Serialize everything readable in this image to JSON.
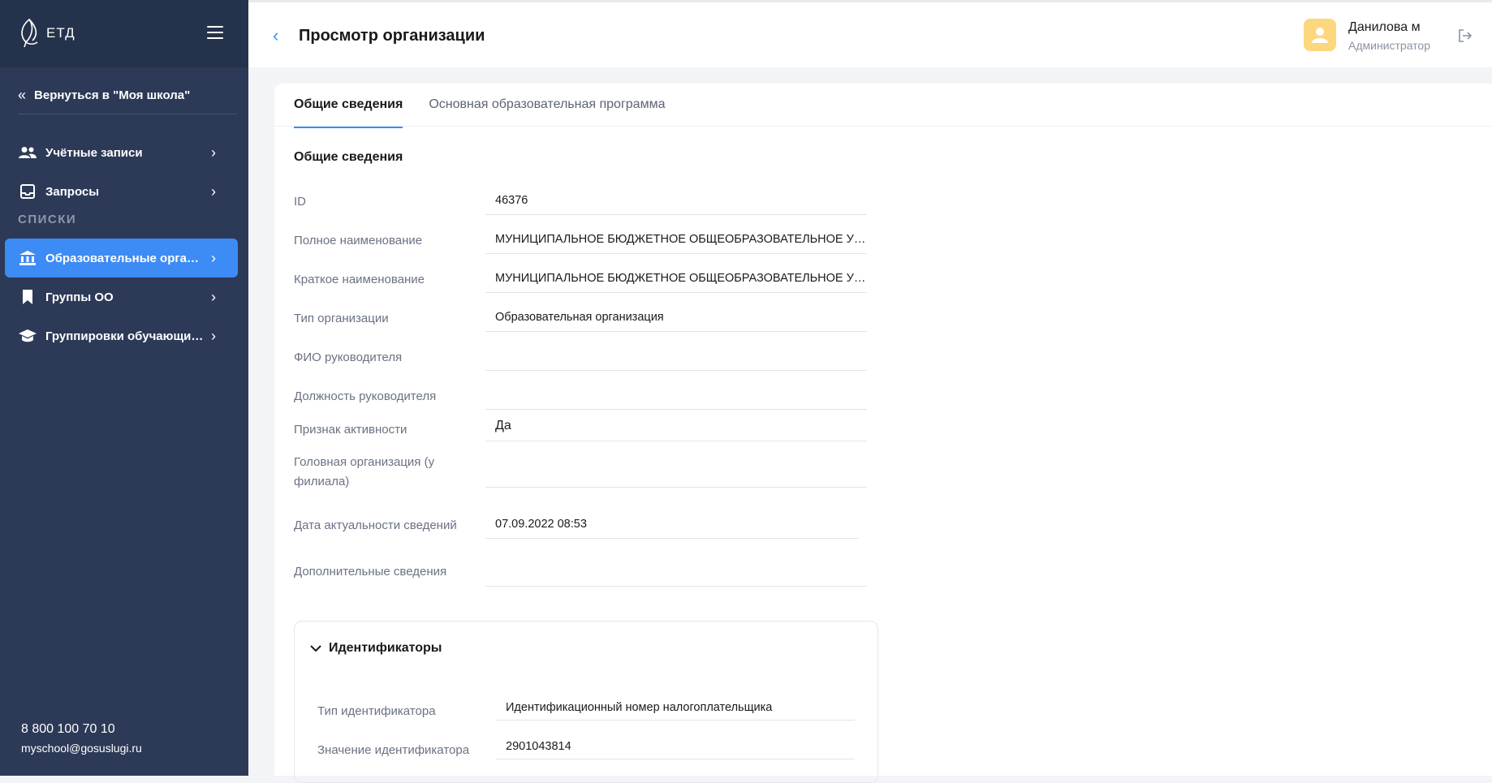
{
  "sidebar": {
    "logo_text": "ЕТД",
    "back_label": "Вернуться в \"Моя школа\"",
    "items_top": [
      {
        "label": "Учётные записи",
        "icon": "users-icon"
      },
      {
        "label": "Запросы",
        "icon": "inbox-icon"
      }
    ],
    "section_label": "СПИСКИ",
    "items_lists": [
      {
        "label": "Образовательные организа...",
        "icon": "institution-icon",
        "active": true
      },
      {
        "label": "Группы ОО",
        "icon": "bookmark-icon"
      },
      {
        "label": "Группировки обучающихся",
        "icon": "graduation-cap-icon"
      }
    ],
    "contact_phone": "8 800 100 70 10",
    "contact_email": "myschool@gosuslugi.ru"
  },
  "header": {
    "title": "Просмотр организации",
    "user_name": "Данилова м",
    "user_role": "Администратор"
  },
  "tabs": [
    {
      "label": "Общие сведения",
      "active": true
    },
    {
      "label": "Основная образовательная программа",
      "active": false
    }
  ],
  "general": {
    "section_title": "Общие сведения",
    "fields": [
      {
        "label": "ID",
        "value": "46376"
      },
      {
        "label": "Полное наименование",
        "value": "МУНИЦИПАЛЬНОЕ БЮДЖЕТНОЕ ОБЩЕОБРАЗОВАТЕЛЬНОЕ УЧ..."
      },
      {
        "label": "Краткое наименование",
        "value": "МУНИЦИПАЛЬНОЕ БЮДЖЕТНОЕ ОБЩЕОБРАЗОВАТЕЛЬНОЕ УЧ..."
      },
      {
        "label": "Тип организации",
        "value": "Образовательная организация"
      },
      {
        "label": "ФИО руководителя",
        "value": ""
      },
      {
        "label": "Должность руководителя",
        "value": ""
      },
      {
        "label": "Признак активности",
        "value": "Да"
      },
      {
        "label": "Головная организация (у филиала)",
        "value": ""
      },
      {
        "label": "Дата актуальности сведений",
        "value": "07.09.2022 08:53"
      },
      {
        "label": "Дополнительные сведения",
        "value": ""
      }
    ]
  },
  "identifiers": {
    "title": "Идентификаторы",
    "fields": [
      {
        "label": "Тип идентификатора",
        "value": "Идентификационный номер налогоплательщика"
      },
      {
        "label": "Значение идентификатора",
        "value": "2901043814"
      }
    ]
  },
  "colors": {
    "sidebar_bg": "#2c3a57",
    "accent": "#3d8bf5",
    "avatar_bg": "#fcd77e"
  }
}
